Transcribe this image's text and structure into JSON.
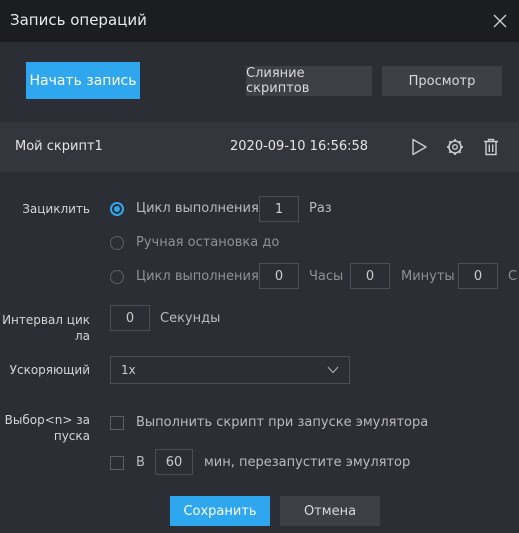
{
  "window": {
    "title": "Запись операций"
  },
  "toolbar": {
    "start_record_label": "Начать запись",
    "merge_scripts_label": "Слияние скриптов",
    "preview_label": "Просмотр"
  },
  "script": {
    "name": "Мой скрипт1",
    "timestamp": "2020-09-10 16:56:58"
  },
  "loop": {
    "label": "Зациклить",
    "option_count": {
      "label": "Цикл выполнения",
      "value": "1",
      "unit": "Раз",
      "selected": true
    },
    "option_manual": {
      "label": "Ручная остановка до",
      "selected": false
    },
    "option_time": {
      "label": "Цикл выполнения",
      "hours_value": "0",
      "hours_unit": "Часы",
      "minutes_value": "0",
      "minutes_unit": "Минуты",
      "seconds_value": "0",
      "seconds_unit_partial": "С",
      "selected": false
    }
  },
  "interval": {
    "label_line1": "Интервал цик",
    "label_line2": "ла",
    "value": "0",
    "unit": "Секунды"
  },
  "speed": {
    "label": "Ускоряющий",
    "selected": "1x"
  },
  "launch": {
    "label_line1": "Выбор<n> за",
    "label_line2": "пуска",
    "run_on_start_label": "Выполнить скрипт при запуске эмулятора",
    "restart_prefix": "В",
    "restart_value": "60",
    "restart_suffix": "мин, перезапустите эмулятор"
  },
  "footer": {
    "save_label": "Сохранить",
    "cancel_label": "Отмена"
  },
  "colors": {
    "accent": "#2ea7ef",
    "titlebar": "#1b1d21",
    "panel": "#2b2e34",
    "row": "#33363c"
  }
}
